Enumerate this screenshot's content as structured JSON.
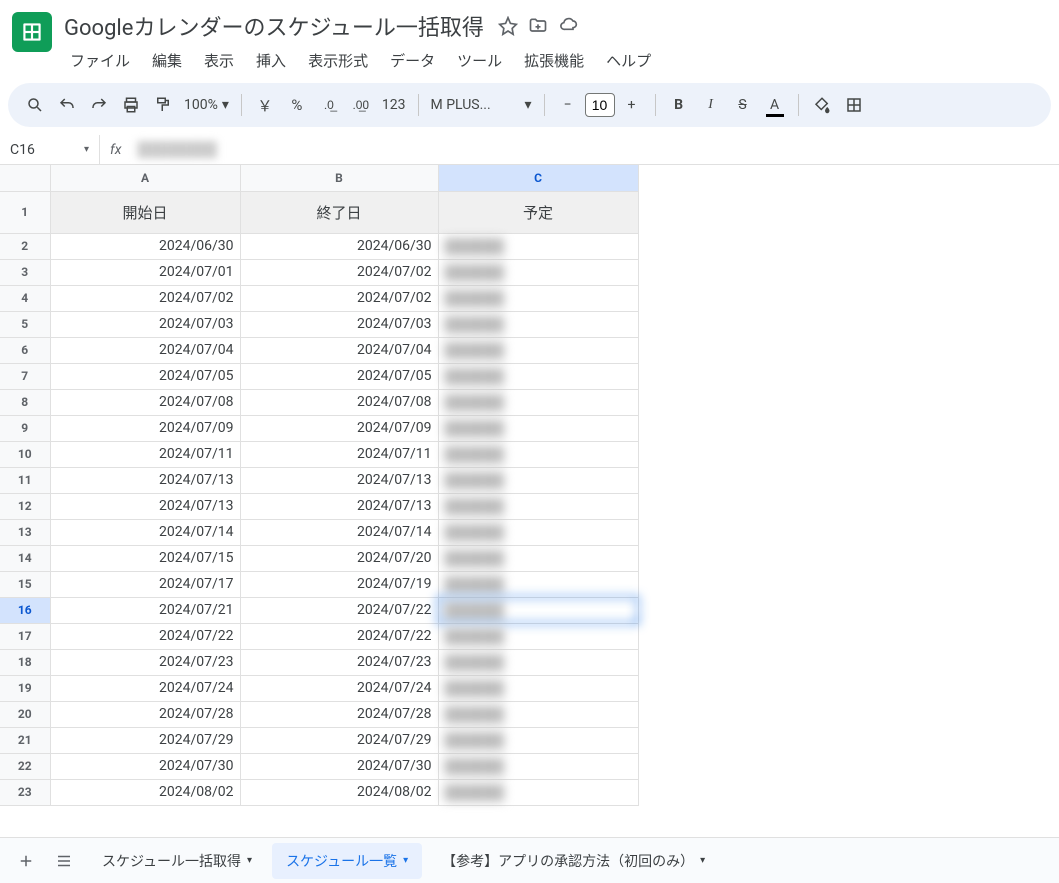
{
  "doc": {
    "title": "Googleカレンダーのスケジュール一括取得"
  },
  "menu": {
    "items": [
      "ファイル",
      "編集",
      "表示",
      "挿入",
      "表示形式",
      "データ",
      "ツール",
      "拡張機能",
      "ヘルプ"
    ]
  },
  "toolbar": {
    "zoom": "100%",
    "currency": "￥",
    "percent": "%",
    "num123": "123",
    "font": "M PLUS...",
    "fontsize": "10"
  },
  "namebox": "C16",
  "fx": "fx",
  "columns": [
    "A",
    "B",
    "C"
  ],
  "selectedCol": "C",
  "selectedRow": 16,
  "headers": {
    "A": "開始日",
    "B": "終了日",
    "C": "予定"
  },
  "rows": [
    {
      "n": 1
    },
    {
      "n": 2,
      "A": "2024/06/30",
      "B": "2024/06/30"
    },
    {
      "n": 3,
      "A": "2024/07/01",
      "B": "2024/07/02"
    },
    {
      "n": 4,
      "A": "2024/07/02",
      "B": "2024/07/02"
    },
    {
      "n": 5,
      "A": "2024/07/03",
      "B": "2024/07/03"
    },
    {
      "n": 6,
      "A": "2024/07/04",
      "B": "2024/07/04"
    },
    {
      "n": 7,
      "A": "2024/07/05",
      "B": "2024/07/05"
    },
    {
      "n": 8,
      "A": "2024/07/08",
      "B": "2024/07/08"
    },
    {
      "n": 9,
      "A": "2024/07/09",
      "B": "2024/07/09"
    },
    {
      "n": 10,
      "A": "2024/07/11",
      "B": "2024/07/11"
    },
    {
      "n": 11,
      "A": "2024/07/13",
      "B": "2024/07/13"
    },
    {
      "n": 12,
      "A": "2024/07/13",
      "B": "2024/07/13"
    },
    {
      "n": 13,
      "A": "2024/07/14",
      "B": "2024/07/14"
    },
    {
      "n": 14,
      "A": "2024/07/15",
      "B": "2024/07/20"
    },
    {
      "n": 15,
      "A": "2024/07/17",
      "B": "2024/07/19"
    },
    {
      "n": 16,
      "A": "2024/07/21",
      "B": "2024/07/22"
    },
    {
      "n": 17,
      "A": "2024/07/22",
      "B": "2024/07/22"
    },
    {
      "n": 18,
      "A": "2024/07/23",
      "B": "2024/07/23"
    },
    {
      "n": 19,
      "A": "2024/07/24",
      "B": "2024/07/24"
    },
    {
      "n": 20,
      "A": "2024/07/28",
      "B": "2024/07/28"
    },
    {
      "n": 21,
      "A": "2024/07/29",
      "B": "2024/07/29"
    },
    {
      "n": 22,
      "A": "2024/07/30",
      "B": "2024/07/30"
    },
    {
      "n": 23,
      "A": "2024/08/02",
      "B": "2024/08/02"
    }
  ],
  "tabs": [
    {
      "label": "スケジュール一括取得",
      "active": false
    },
    {
      "label": "スケジュール一覧",
      "active": true
    },
    {
      "label": "【参考】アプリの承認方法（初回のみ）",
      "active": false
    }
  ]
}
